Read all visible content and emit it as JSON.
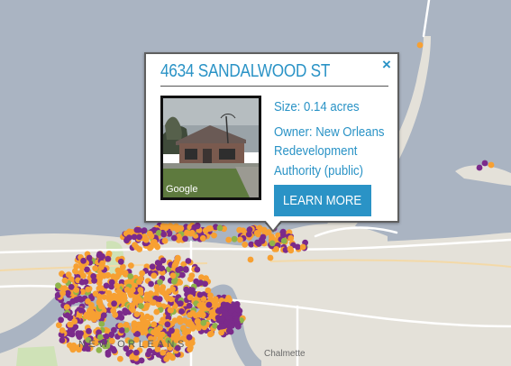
{
  "map": {
    "city_label": "NEW ORLEANS",
    "place_label": "Chalmette",
    "colors": {
      "water": "#aab4c2",
      "land": "#e4e1d9",
      "park": "#cfe2b7",
      "road": "#ffffff",
      "orange_marker": "#f7a032",
      "purple_marker": "#7b2a8b",
      "green_marker": "#8fb44a"
    }
  },
  "popup": {
    "address": "4634 SANDALWOOD ST",
    "close_icon": "close-icon",
    "image_watermark": "Google",
    "size_line": "Size: 0.14 acres",
    "owner_lines": [
      "Owner: New Orleans",
      "Redevelopment",
      "Authority (public)"
    ],
    "button_label": "LEARN MORE"
  }
}
